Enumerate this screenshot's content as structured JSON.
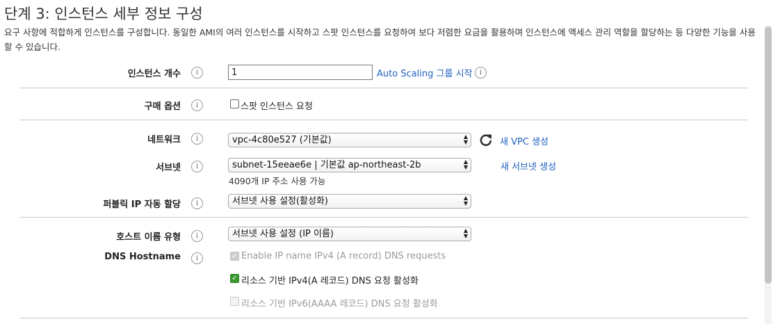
{
  "header": {
    "title": "단계 3: 인스턴스 세부 정보 구성",
    "description": "요구 사항에 적합하게 인스턴스를 구성합니다. 동일한 AMI의 여러 인스턴스를 시작하고 스팟 인스턴스를 요청하여 보다 저렴한 요금을 활용하며 인스턴스에 액세스 관리 역할을 할당하는 등 다양한 기능을 사용할 수 있습니다."
  },
  "fields": {
    "instance_count": {
      "label": "인스턴스 개수",
      "value": "1",
      "link": "Auto Scaling 그룹 시작"
    },
    "purchase_option": {
      "label": "구매 옵션",
      "checkbox_label": "스팟 인스턴스 요청"
    },
    "network": {
      "label": "네트워크",
      "selected": "vpc-4c80e527 (기본값)",
      "link": "새 VPC 생성"
    },
    "subnet": {
      "label": "서브넷",
      "selected": "subnet-15eeae6e | 기본값 ap-northeast-2b",
      "helper": "4090개 IP 주소 사용 가능",
      "link": "새 서브넷 생성"
    },
    "public_ip": {
      "label": "퍼블릭 IP 자동 할당",
      "selected": "서브넷 사용 설정(활성화)"
    },
    "hostname_type": {
      "label": "호스트 이름 유형",
      "selected": "서브넷 사용 설정 (IP 이름)"
    },
    "dns_hostname": {
      "label": "DNS Hostname",
      "options": [
        {
          "label": "Enable IP name IPv4 (A record) DNS requests",
          "checked": true,
          "disabled": true
        },
        {
          "label": "리소스 기반 IPv4(A 레코드) DNS 요청 활성화",
          "checked": true,
          "disabled": false
        },
        {
          "label": "리소스 기반 IPv6(AAAA 레코드) DNS 요청 활성화",
          "checked": false,
          "disabled": true
        }
      ]
    }
  },
  "icons": {
    "info": "info-icon",
    "refresh": "refresh-icon",
    "select_arrow": "select-arrows-icon"
  },
  "colors": {
    "link": "#1f5fbf",
    "checkbox_checked": "#3a9a2f"
  }
}
